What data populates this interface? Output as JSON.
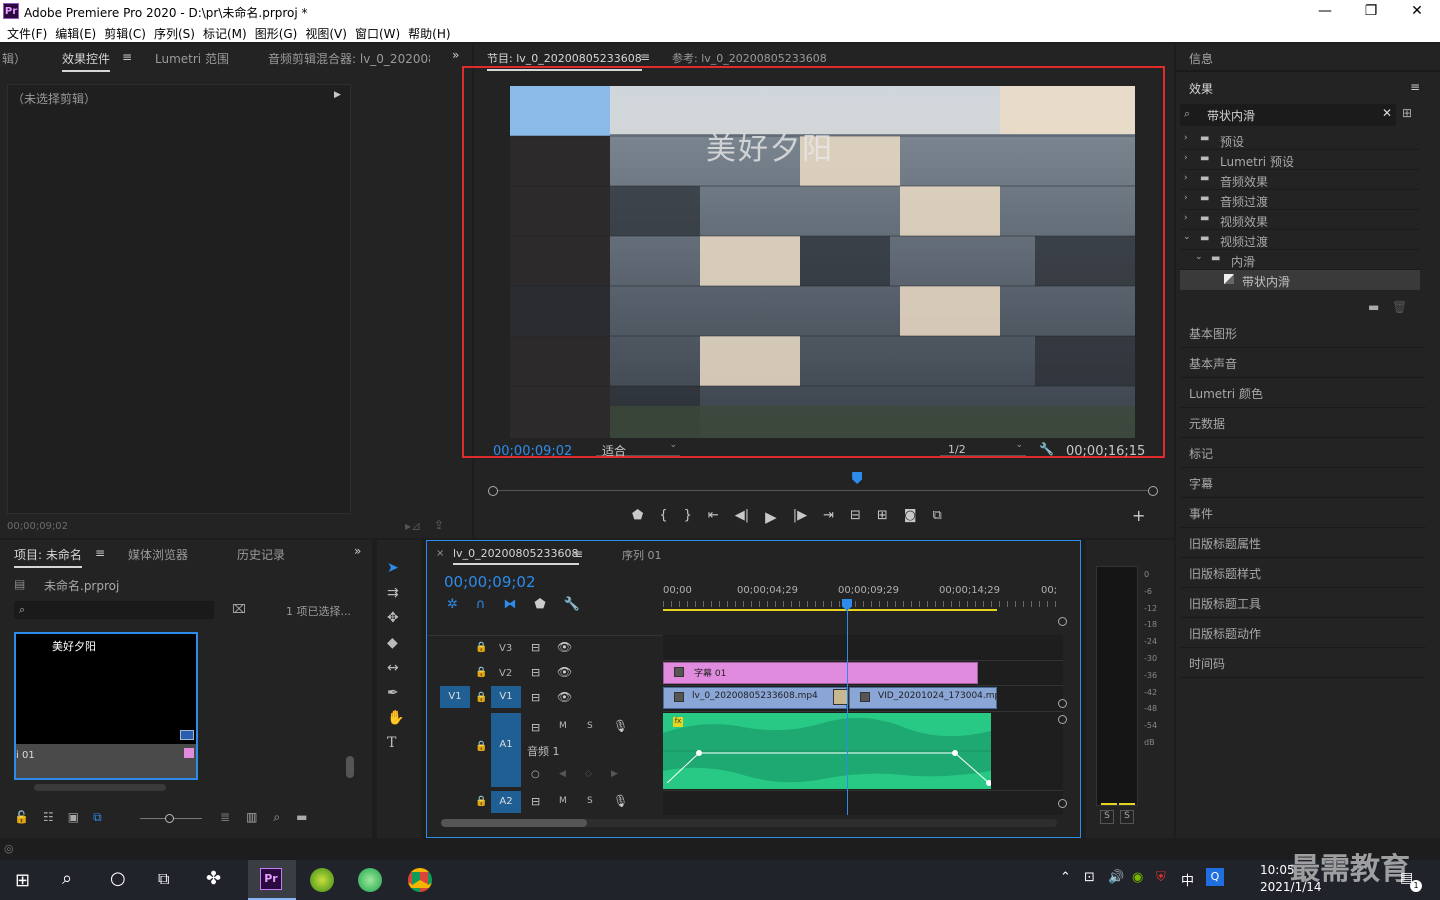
{
  "window": {
    "app_logo": "Pr",
    "title": "Adobe Premiere Pro 2020 - D:\\pr\\未命名.prproj *",
    "buttons": {
      "minimize": "—",
      "maximize": "❐",
      "close": "✕"
    }
  },
  "menu": [
    "文件(F)",
    "编辑(E)",
    "剪辑(C)",
    "序列(S)",
    "标记(M)",
    "图形(G)",
    "视图(V)",
    "窗口(W)",
    "帮助(H)"
  ],
  "source_panel": {
    "tabs": [
      "辑）",
      "效果控件",
      "Lumetri 范围",
      "音频剪辑混合器: lv_0_202008"
    ],
    "no_clip": "（未选择剪辑）",
    "timecode": "00;00;09;02"
  },
  "program_monitor": {
    "tab_program": "节目: lv_0_20200805233608",
    "tab_reference": "参考: lv_0_20200805233608",
    "overlay_title": "美好夕阳",
    "current_time": "00;00;09;02",
    "fit": "适合",
    "resolution": "1/2",
    "duration": "00;00;16;15",
    "playhead_fraction": 0.55
  },
  "project_panel": {
    "tabs": [
      "项目: 未命名",
      "媒体浏览器",
      "历史记录"
    ],
    "project_file": "未命名.prproj",
    "selection": "1 项已选择...",
    "thumb_text": "美好夕阳",
    "thumb_label": "i 01"
  },
  "timeline": {
    "tab_sequence": "lv_0_20200805233608",
    "tab_sequence2": "序列 01",
    "current_time": "00;00;09;02",
    "ruler": [
      "00;00",
      "00;00;04;29",
      "00;00;09;29",
      "00;00;14;29",
      "00;"
    ],
    "tracks": {
      "v3": "V3",
      "v2": "V2",
      "v1": "V1",
      "v1_src": "V1",
      "a1": "A1",
      "a2": "A2",
      "a1_name": "音频 1",
      "m": "M",
      "s": "S"
    },
    "clips": {
      "title": "字幕 01",
      "video1": "lv_0_20200805233608.mp4",
      "video2": "VID_20201024_173004.mp4"
    }
  },
  "audio_meter": {
    "scale": [
      "0",
      "-6",
      "-12",
      "-18",
      "-24",
      "-30",
      "-36",
      "-42",
      "-48",
      "-54",
      "dB"
    ],
    "solo": [
      "S",
      "S"
    ]
  },
  "effects_panel": {
    "info": "信息",
    "title": "效果",
    "search_value": "带状内滑",
    "tree": [
      {
        "label": "预设",
        "level": 0
      },
      {
        "label": "Lumetri 预设",
        "level": 0
      },
      {
        "label": "音频效果",
        "level": 0
      },
      {
        "label": "音频过渡",
        "level": 0
      },
      {
        "label": "视频效果",
        "level": 0
      },
      {
        "label": "视频过渡",
        "level": 0
      },
      {
        "label": "内滑",
        "level": 1
      },
      {
        "label": "带状内滑",
        "level": 2
      }
    ],
    "side_panels": [
      "基本图形",
      "基本声音",
      "Lumetri 颜色",
      "元数据",
      "标记",
      "字幕",
      "事件",
      "旧版标题属性",
      "旧版标题样式",
      "旧版标题工具",
      "旧版标题动作",
      "时间码"
    ]
  },
  "taskbar": {
    "time": "10:05",
    "date": "2021/1/14",
    "ime": "中",
    "watermark": "最需教育",
    "notif_count": "1"
  },
  "colors": {
    "accent_blue": "#2d8ceb",
    "track_select": "#1f5f94",
    "clip_pink": "#e18bdf",
    "clip_blue": "#8aa6d6",
    "audio_green": "#27c985",
    "highlight_red": "#e02b2b"
  }
}
